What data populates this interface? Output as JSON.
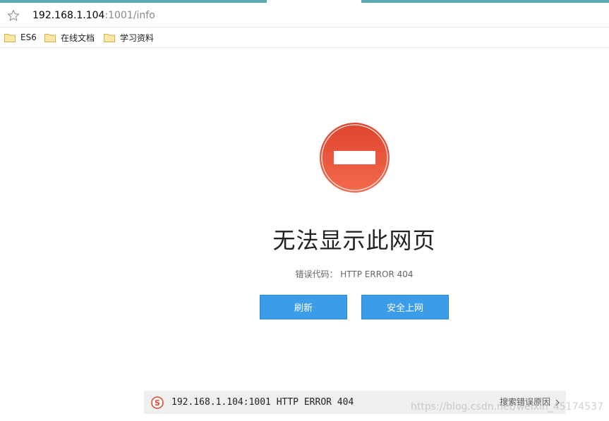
{
  "browser": {
    "url_host": "192.168.1.104",
    "url_rest": ":1001/info",
    "tabstrip_color": "#5ea8b3"
  },
  "bookmarks": [
    {
      "label": "ES6",
      "icon": "folder-icon"
    },
    {
      "label": "在线文档",
      "icon": "folder-icon"
    },
    {
      "label": "学习资料",
      "icon": "folder-icon"
    }
  ],
  "error": {
    "icon": "no-entry-icon",
    "title": "无法显示此网页",
    "code_text": "错误代码： HTTP ERROR 404",
    "refresh_label": "刷新",
    "safe_browse_label": "安全上网",
    "accent_color": "#3b9ce8",
    "icon_color": "#e8563b"
  },
  "search_bar": {
    "icon": "sogou-icon",
    "query": "192.168.1.104:1001 HTTP ERROR 404",
    "link_label": "搜索错误原因"
  },
  "watermark": "https://blog.csdn.net/weixin_45174537"
}
